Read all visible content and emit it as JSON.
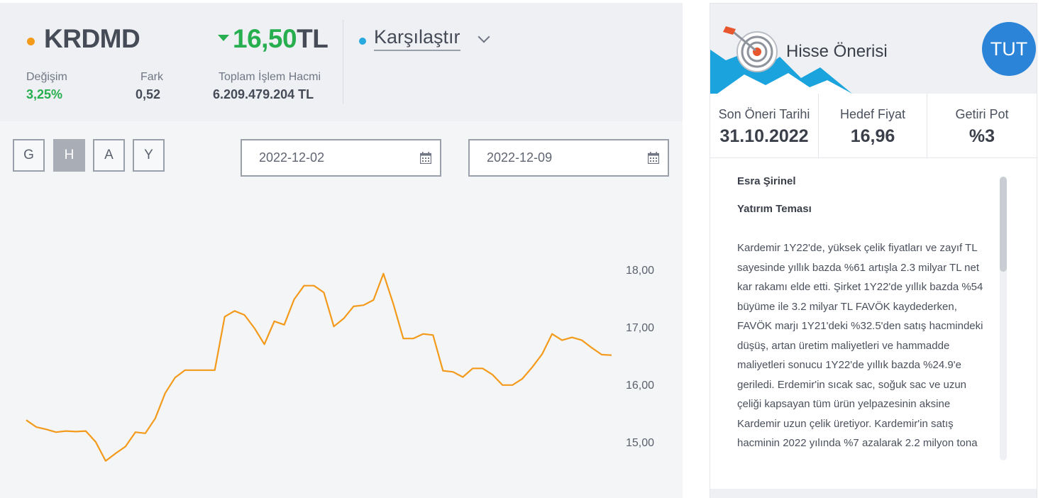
{
  "stock": {
    "symbol": "KRDMD",
    "price_value": "16,50",
    "price_currency": "TL",
    "price_direction": "down",
    "change_label": "Değişim",
    "change_value": "3,25%",
    "diff_label": "Fark",
    "diff_value": "0,52",
    "volume_label": "Toplam İşlem Hacmi",
    "volume_value": "6.209.479.204 TL",
    "compare_label": "Karşılaştır"
  },
  "ranges": [
    {
      "label": "G",
      "active": false
    },
    {
      "label": "H",
      "active": true
    },
    {
      "label": "A",
      "active": false
    },
    {
      "label": "Y",
      "active": false
    }
  ],
  "dates": {
    "start": "2022-12-02",
    "end": "2022-12-09"
  },
  "colors": {
    "line": "#f39a1b",
    "up": "#27ae4f",
    "accent": "#2b84d8"
  },
  "chart_data": {
    "type": "line",
    "title": "",
    "xlabel": "",
    "ylabel": "",
    "ylim": [
      14.7,
      18.8
    ],
    "y_ticks": [
      "15,00",
      "16,00",
      "17,00",
      "18,00"
    ],
    "y_tick_values": [
      15.0,
      16.0,
      17.0,
      18.0
    ],
    "grid": false,
    "series": [
      {
        "values": [
          15.38,
          15.26,
          15.22,
          15.17,
          15.19,
          15.18,
          15.19,
          15.0,
          14.67,
          14.8,
          14.92,
          15.17,
          15.15,
          15.41,
          15.85,
          16.12,
          16.25,
          16.25,
          16.25,
          16.25,
          17.18,
          17.28,
          17.21,
          16.98,
          16.7,
          17.1,
          17.04,
          17.48,
          17.72,
          17.72,
          17.6,
          17.01,
          17.15,
          17.36,
          17.38,
          17.47,
          17.93,
          17.4,
          16.8,
          16.8,
          16.88,
          16.86,
          16.24,
          16.22,
          16.13,
          16.28,
          16.28,
          16.17,
          15.99,
          15.99,
          16.1,
          16.3,
          16.53,
          16.88,
          16.77,
          16.82,
          16.77,
          16.64,
          16.52,
          16.51
        ]
      }
    ]
  },
  "recommendation": {
    "title": "Hisse Önerisi",
    "badge": "TUT",
    "last_date_label": "Son Öneri Tarihi",
    "last_date_value": "31.10.2022",
    "target_label": "Hedef Fiyat",
    "target_value": "16,96",
    "return_label": "Getiri Pot",
    "return_value": "%3",
    "author": "Esra Şirinel",
    "theme_title": "Yatırım Teması",
    "text": "Kardemir 1Y22'de, yüksek çelik fiyatları ve zayıf TL sayesinde yıllık bazda %61 artışla 2.3 milyar TL net kar rakamı elde etti. Şirket 1Y22'de yıllık bazda %54 büyüme ile 3.2 milyar TL FAVÖK kaydederken, FAVÖK marjı 1Y21'deki %32.5'den satış hacmindeki düşüş, artan üretim maliyetleri ve hammadde maliyetleri sonucu 1Y22'de yıllık bazda %24.9'e geriledi. Erdemir'in sıcak sac, soğuk sac ve uzun çeliği kapsayan tüm ürün yelpazesinin aksine Kardemir uzun çelik üretiyor. Kardemir'in satış hacminin 2022 yılında %7 azalarak 2.2 milyon tona"
  }
}
